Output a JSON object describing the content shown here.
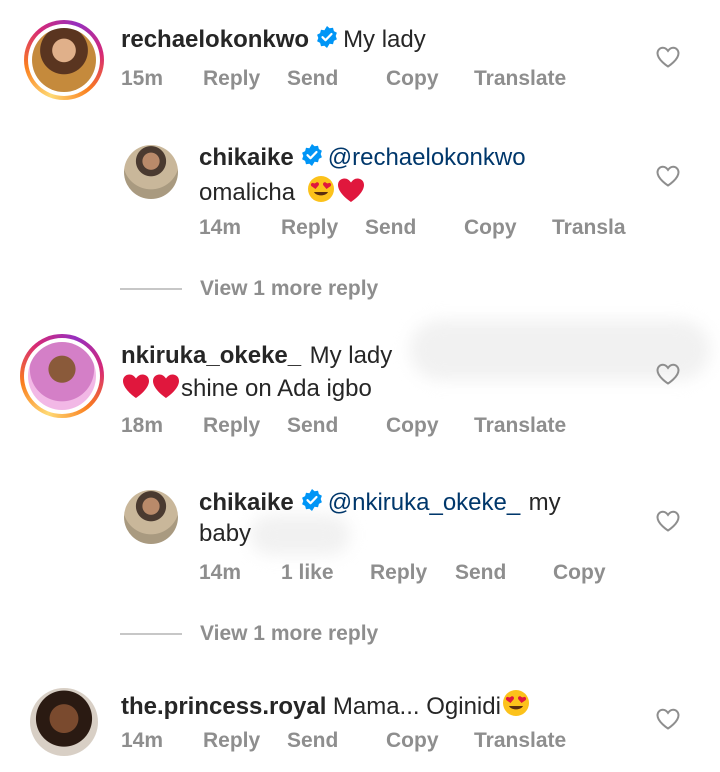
{
  "comments": [
    {
      "username": "rechaelokonkwo",
      "verified": true,
      "text": "My lady",
      "time": "15m",
      "actions": [
        "Reply",
        "Send",
        "Copy",
        "Translate"
      ],
      "avatar_colors": [
        "#c97b3a",
        "#3b2a1e"
      ]
    },
    {
      "username": "chikaike",
      "verified": true,
      "mention": "@rechaelokonkwo",
      "text": "omalicha",
      "time": "14m",
      "actions": [
        "Reply",
        "Send",
        "Copy",
        "Transla"
      ],
      "view_more": "View 1 more reply"
    },
    {
      "username": "nkiruka_okeke_",
      "verified": false,
      "text_line1": "My lady",
      "text_line2": "shine on Ada igbo",
      "time": "18m",
      "actions": [
        "Reply",
        "Send",
        "Copy",
        "Translate"
      ]
    },
    {
      "username": "chikaike",
      "verified": true,
      "mention": "@nkiruka_okeke_",
      "text_line1": "my",
      "text_line2": "baby",
      "time": "14m",
      "likes": "1 like",
      "actions": [
        "Reply",
        "Send",
        "Copy"
      ],
      "view_more": "View 1 more reply"
    },
    {
      "username": "the.princess.royal",
      "verified": false,
      "text": "Mama... Oginidi",
      "time": "14m",
      "actions": [
        "Reply",
        "Send",
        "Copy",
        "Translate"
      ]
    }
  ],
  "colors": {
    "username": "#262626",
    "mention": "#00376b",
    "meta": "#8e8e8e",
    "verified": "#0095f6",
    "heart": "#8e8e8e"
  },
  "icons": [
    "verified-badge-icon",
    "heart-outline-icon",
    "heart-emoji",
    "heart-eyes-emoji"
  ]
}
